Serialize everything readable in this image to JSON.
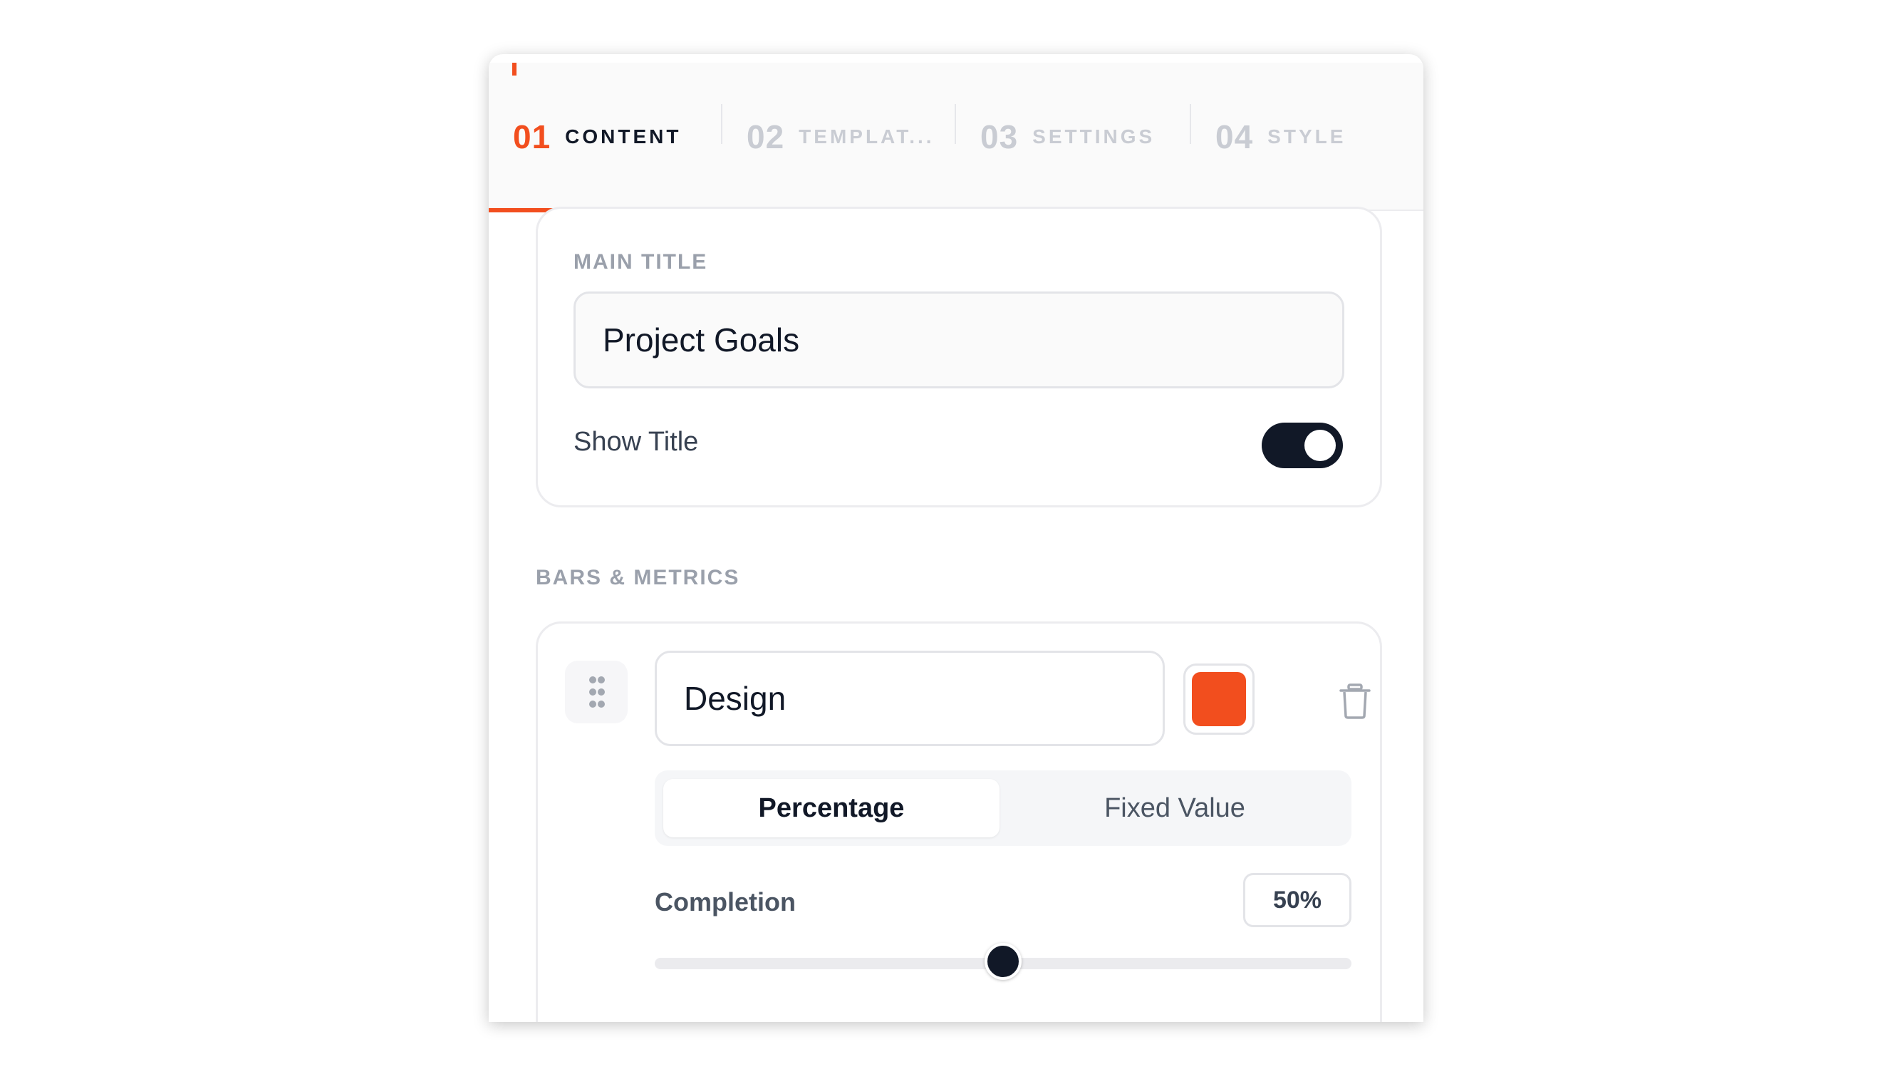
{
  "tabs": [
    {
      "num": "01",
      "label": "CONTENT",
      "active": true
    },
    {
      "num": "02",
      "label": "TEMPLAT...",
      "active": false
    },
    {
      "num": "03",
      "label": "SETTINGS",
      "active": false
    },
    {
      "num": "04",
      "label": "STYLE",
      "active": false
    }
  ],
  "main_title": {
    "label": "MAIN TITLE",
    "value": "Project Goals",
    "show_title_label": "Show Title",
    "show_title_on": true
  },
  "bars_section": {
    "heading": "BARS & METRICS",
    "bars": [
      {
        "name": "Design",
        "color": "#f24e1e",
        "mode_options": [
          "Percentage",
          "Fixed Value"
        ],
        "selected_mode": "Percentage",
        "completion_label": "Completion",
        "completion_display": "50%",
        "completion_percent": 50
      }
    ]
  },
  "colors": {
    "accent": "#f24e1e",
    "dark": "#111827",
    "muted": "#9aa0ab"
  }
}
